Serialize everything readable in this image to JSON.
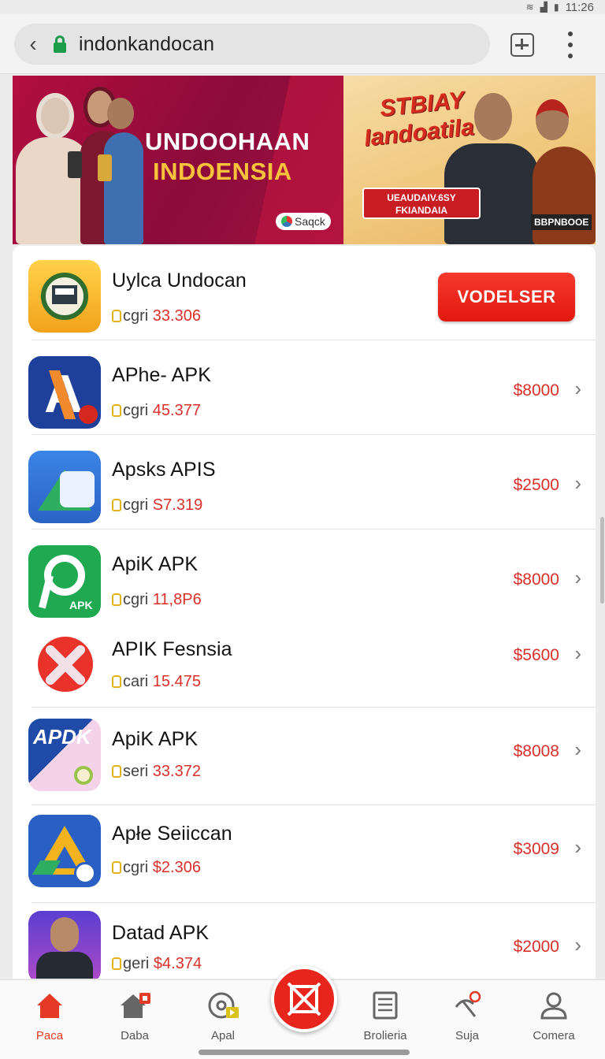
{
  "status_bar": {
    "time": "11:26"
  },
  "browser": {
    "url": "indonkandocan"
  },
  "banner": {
    "left_title_1": "UNDOOHAAN",
    "left_title_2": "INDOENSIA",
    "left_logo": "Saqck",
    "right_title_1": "STBIAY",
    "right_title_2": "Iandoatila",
    "right_box_line_1": "UEAUDAIV.6SY",
    "right_box_line_2": "FKIANDAIA",
    "right_tag": "BBPNBOOE"
  },
  "apps": [
    {
      "name": "Uylca Undocan",
      "count_label": "cgri",
      "count": "33.306",
      "action": "VODELSER",
      "icon": "wreath-house-icon"
    },
    {
      "name": "APhe- APK",
      "count_label": "cgri",
      "count": "45.377",
      "price": "$8000",
      "icon": "letter-a-icon"
    },
    {
      "name": "Apsks APIS",
      "count_label": "cgri",
      "count": "S7.319",
      "price": "$2500",
      "icon": "drive-like-icon"
    },
    {
      "name": "ApiK APK",
      "count_label": "cgri",
      "count": "11,8P6",
      "price": "$8000",
      "icon": "apk-p-icon",
      "icon_text": "APK"
    },
    {
      "name": "APIK Fesnsia",
      "count_label": "cari",
      "count": "15.475",
      "price": "$5600",
      "icon": "crossed-circle-icon"
    },
    {
      "name": "ApiK APK",
      "count_label": "seri",
      "count": "33.372",
      "price": "$8008",
      "icon": "apdk-icon",
      "icon_text": "APDK"
    },
    {
      "name": "Apłe Seiiccan",
      "count_label": "cgri",
      "count": "$2.306",
      "price": "$3009",
      "icon": "triangle-drive-icon"
    },
    {
      "name": "Datad APK",
      "count_label": "geri",
      "count": "$4.374",
      "price": "$2000",
      "icon": "person-photo-icon"
    }
  ],
  "nav": [
    {
      "label": "Paca",
      "icon": "home-icon",
      "active": true
    },
    {
      "label": "Daba",
      "icon": "store-icon"
    },
    {
      "label": "Apal",
      "icon": "disc-icon"
    },
    {
      "label": "Brolieria",
      "icon": "document-icon"
    },
    {
      "label": "Suja",
      "icon": "signal-icon"
    },
    {
      "label": "Comera",
      "icon": "person-icon"
    }
  ],
  "colors": {
    "accent": "#e8251c",
    "price": "#d9302a",
    "lock": "#1c9b4b"
  }
}
